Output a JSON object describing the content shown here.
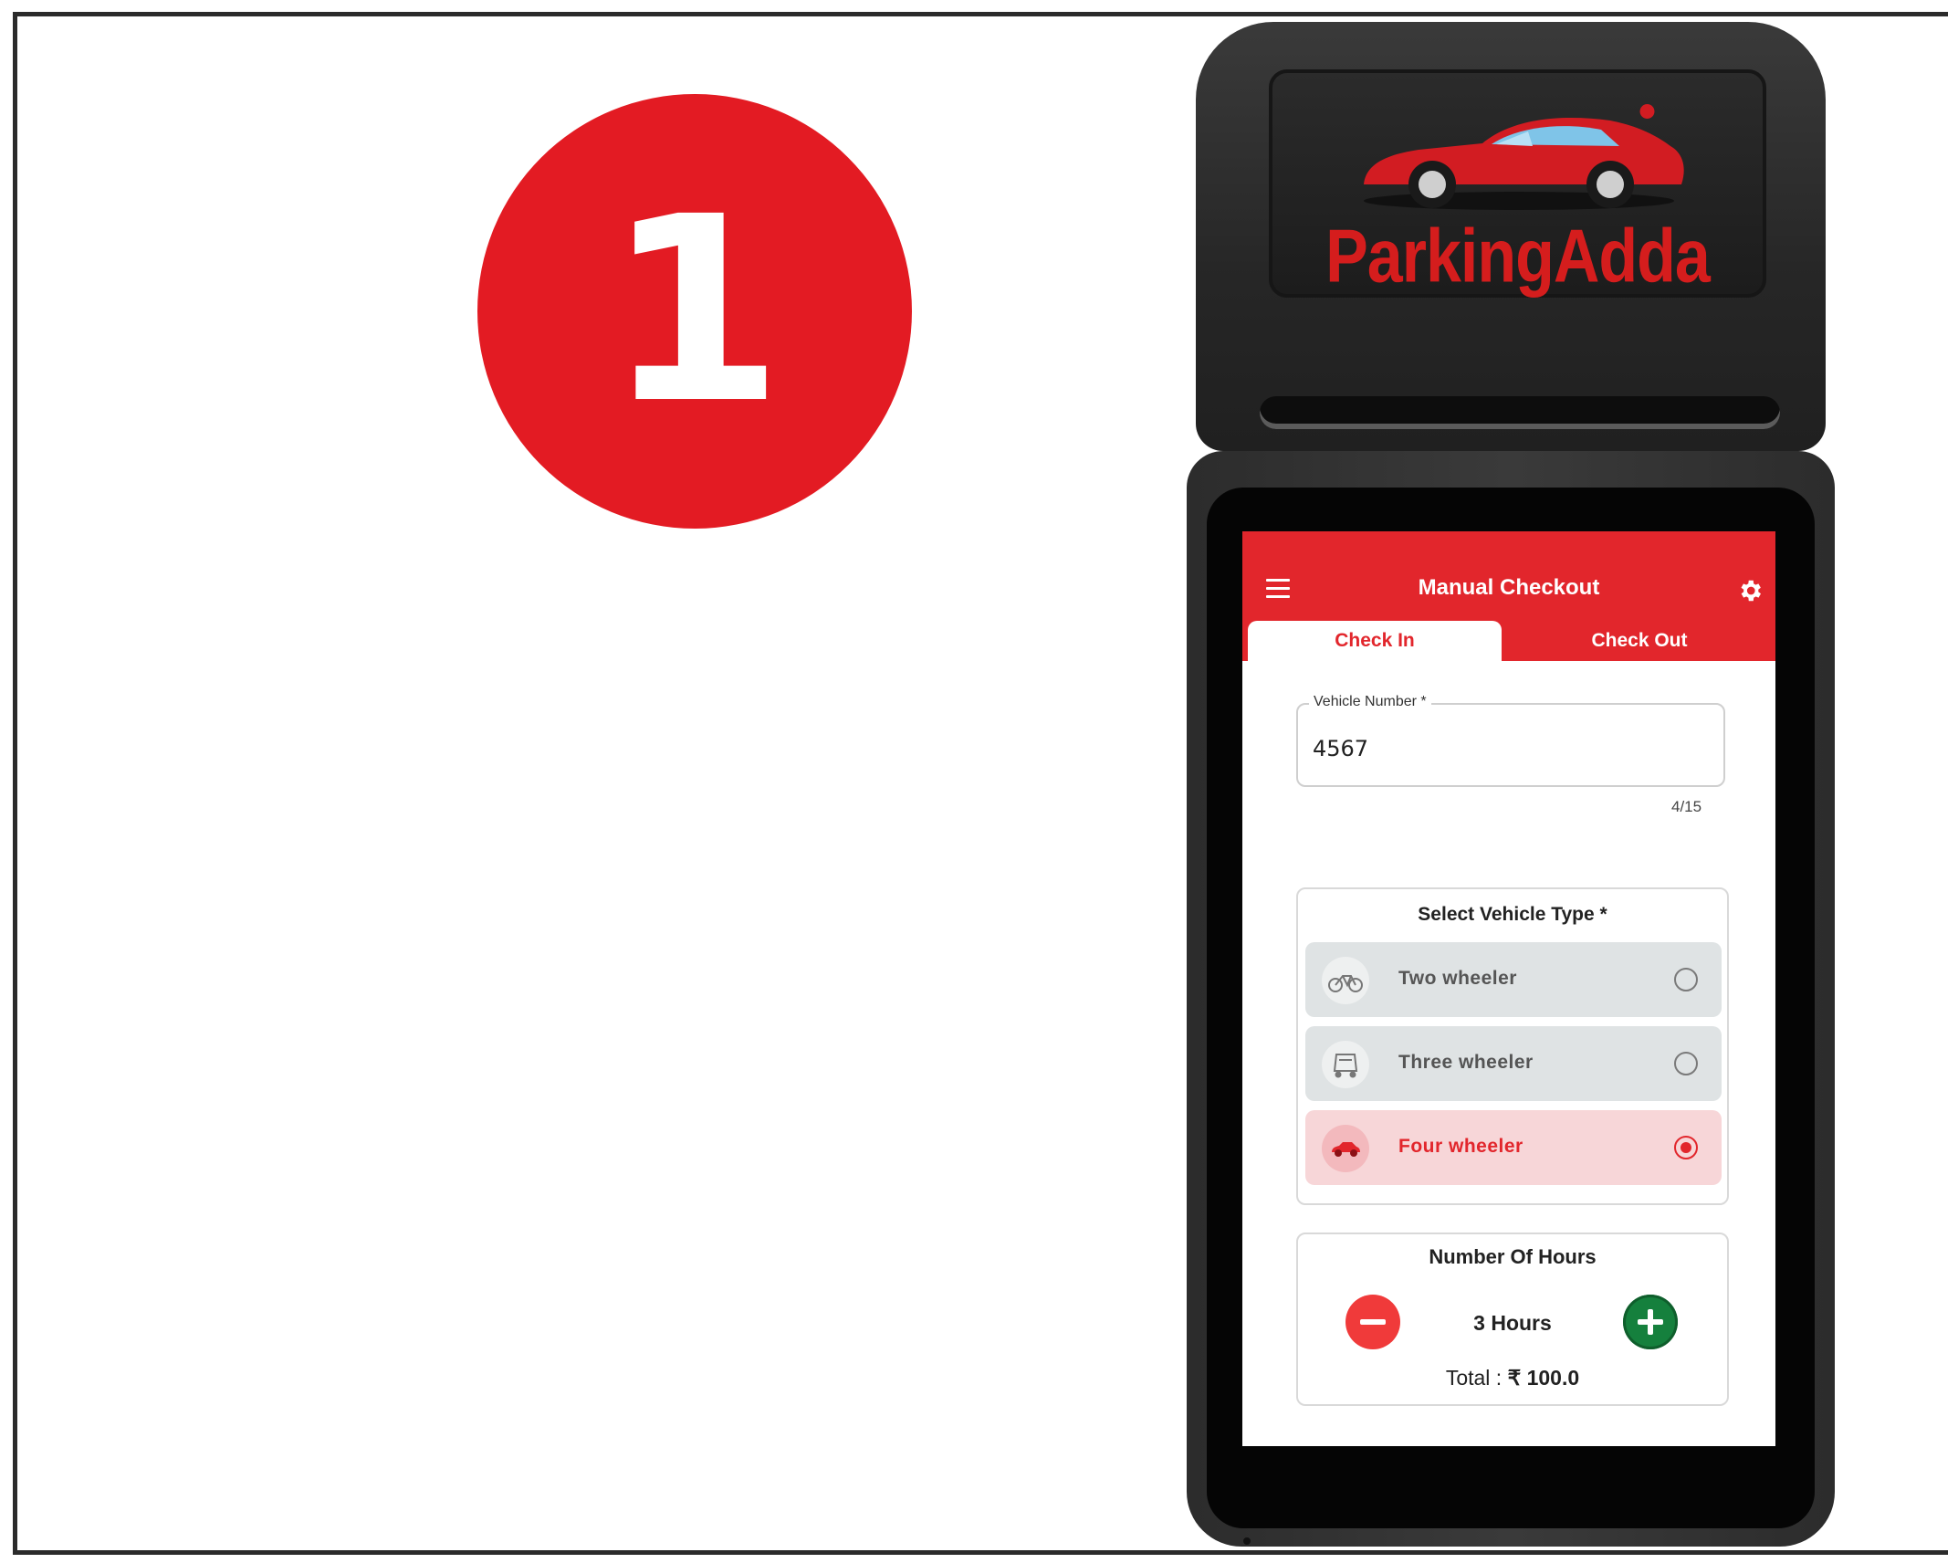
{
  "step_number": "1",
  "device": {
    "brand": "ParkingAdda"
  },
  "app": {
    "title": "Manual Checkout",
    "tabs": [
      {
        "label": "Check In",
        "active": true
      },
      {
        "label": "Check Out",
        "active": false
      }
    ],
    "vehicle_number": {
      "label": "Vehicle Number *",
      "value": "4567",
      "counter": "4/15"
    },
    "vehicle_type": {
      "title": "Select Vehicle Type *",
      "options": [
        {
          "label": "Two wheeler",
          "icon": "motorcycle-icon",
          "selected": false
        },
        {
          "label": "Three wheeler",
          "icon": "auto-rickshaw-icon",
          "selected": false
        },
        {
          "label": "Four wheeler",
          "icon": "car-icon",
          "selected": true
        }
      ]
    },
    "hours": {
      "title": "Number Of Hours",
      "value": "3 Hours",
      "total_label": "Total :",
      "total_value": "₹ 100.0"
    }
  },
  "colors": {
    "accent": "#e2262c",
    "badge": "#e31b23",
    "plus": "#15803d",
    "minus": "#f03a3a"
  }
}
